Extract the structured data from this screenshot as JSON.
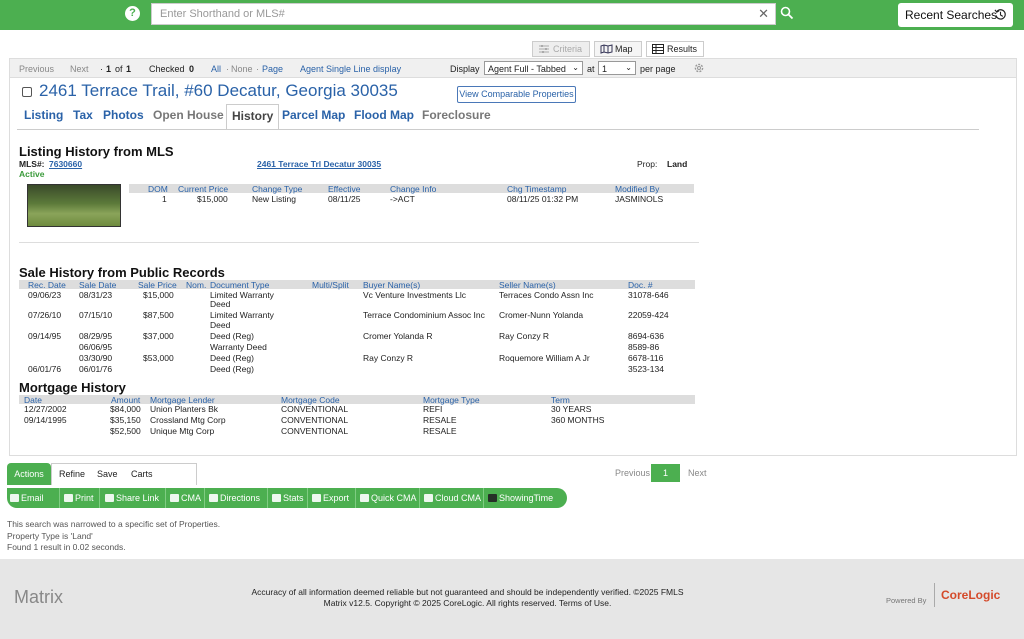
{
  "search": {
    "placeholder": "Enter Shorthand or MLS#",
    "recent_label": "Recent Searches"
  },
  "view_tabs": {
    "criteria": "Criteria",
    "map": "Map",
    "results": "Results"
  },
  "pagebar": {
    "previous": "Previous",
    "next": "Next",
    "page_prefix": "·",
    "page_current": "1",
    "page_of": "of",
    "page_total": "1",
    "checked_label": "Checked",
    "checked_count": "0",
    "all": "All",
    "none": "None",
    "page": "Page",
    "dot": "·",
    "agent_single": "Agent Single Line display",
    "display_label": "Display",
    "display_value": "Agent Full - Tabbed",
    "at_label": "at",
    "per_page_value": "1",
    "per_page_label": "per page"
  },
  "listing": {
    "address": "2461 Terrace Trail, #60 Decatur, Georgia 30035",
    "comparable_btn": "View Comparable Properties",
    "tabs": [
      "Listing",
      "Tax",
      "Photos",
      "Open House",
      "History",
      "Parcel Map",
      "Flood Map",
      "Foreclosure"
    ]
  },
  "mls_history": {
    "title": "Listing History from MLS",
    "mls_label": "MLS#:",
    "mls_number": "7630660",
    "status": "Active",
    "address_link": "2461 Terrace Trl Decatur 30035",
    "prop_label": "Prop:",
    "prop_value": "Land",
    "headers": [
      "DOM",
      "Current Price",
      "Change Type",
      "Effective",
      "Change Info",
      "Chg Timestamp",
      "Modified By"
    ],
    "row": [
      "1",
      "$15,000",
      "New Listing",
      "08/11/25",
      "->ACT",
      "08/11/25 01:32 PM",
      "JASMINOLS"
    ]
  },
  "sale_history": {
    "title": "Sale History from Public Records",
    "headers": [
      "Rec. Date",
      "Sale Date",
      "Sale Price",
      "Nom.",
      "Document Type",
      "Multi/Split",
      "Buyer Name(s)",
      "Seller Name(s)",
      "Doc. #"
    ],
    "rows": [
      {
        "rec": "09/06/23",
        "sale": "08/31/23",
        "price": "$15,000",
        "doc_type": "Limited Warranty",
        "doc_type2": "Deed",
        "buyer": "Vc Venture Investments Llc",
        "seller": "Terraces Condo Assn Inc",
        "doc": "31078-646"
      },
      {
        "rec": "07/26/10",
        "sale": "07/15/10",
        "price": "$87,500",
        "doc_type": "Limited Warranty",
        "doc_type2": "Deed",
        "buyer": "Terrace Condominium Assoc Inc",
        "seller": "Cromer-Nunn Yolanda",
        "doc": "22059-424"
      },
      {
        "rec": "09/14/95",
        "sale": "08/29/95",
        "price": "$37,000",
        "doc_type": "Deed (Reg)",
        "doc_type2": "",
        "buyer": "Cromer Yolanda R",
        "seller": "Ray Conzy R",
        "doc": "8694-636"
      },
      {
        "rec": "",
        "sale": "06/06/95",
        "price": "",
        "doc_type": "Warranty Deed",
        "doc_type2": "",
        "buyer": "",
        "seller": "",
        "doc": "8589-86"
      },
      {
        "rec": "",
        "sale": "03/30/90",
        "price": "$53,000",
        "doc_type": "Deed (Reg)",
        "doc_type2": "",
        "buyer": "Ray Conzy R",
        "seller": "Roquemore William A Jr",
        "doc": "6678-116"
      },
      {
        "rec": "06/01/76",
        "sale": "06/01/76",
        "price": "",
        "doc_type": "Deed (Reg)",
        "doc_type2": "",
        "buyer": "",
        "seller": "",
        "doc": "3523-134"
      }
    ]
  },
  "mortgage_history": {
    "title": "Mortgage History",
    "headers": [
      "Date",
      "Amount",
      "Mortgage Lender",
      "Mortgage Code",
      "Mortgage Type",
      "Term"
    ],
    "rows": [
      {
        "date": "12/27/2002",
        "amount": "$84,000",
        "lender": "Union Planters Bk",
        "code": "CONVENTIONAL",
        "type": "REFI",
        "term": "30 YEARS"
      },
      {
        "date": "09/14/1995",
        "amount": "$35,150",
        "lender": "Crossland Mtg Corp",
        "code": "CONVENTIONAL",
        "type": "RESALE",
        "term": "360 MONTHS"
      },
      {
        "date": "",
        "amount": "$52,500",
        "lender": "Unique Mtg Corp",
        "code": "CONVENTIONAL",
        "type": "RESALE",
        "term": ""
      }
    ]
  },
  "action_tabs": [
    "Actions",
    "Refine",
    "Save",
    "Carts"
  ],
  "actions": [
    "Email",
    "Print",
    "Share Link",
    "CMA",
    "Directions",
    "Stats",
    "Export",
    "Quick CMA",
    "Cloud CMA",
    "ShowingTime"
  ],
  "pager": {
    "previous": "Previous",
    "current": "1",
    "next": "Next"
  },
  "notes": [
    "This search was narrowed to a specific set of Properties.",
    "Property Type is 'Land'",
    "Found 1 result in 0.02 seconds."
  ],
  "footer": {
    "brand": "Matrix",
    "disclaimer": "Accuracy of all information deemed reliable but not guaranteed and should be independently verified. ©2025 FMLS",
    "copyright": "Matrix v12.5. Copyright © 2025 CoreLogic. All rights reserved.",
    "terms": "Terms of Use.",
    "powered_by": "Powered By",
    "corelogic": "CoreLogic"
  },
  "colors": {
    "brand_green": "#4caf50",
    "link_blue": "#2a62a8",
    "header_gray": "#dddddd"
  }
}
